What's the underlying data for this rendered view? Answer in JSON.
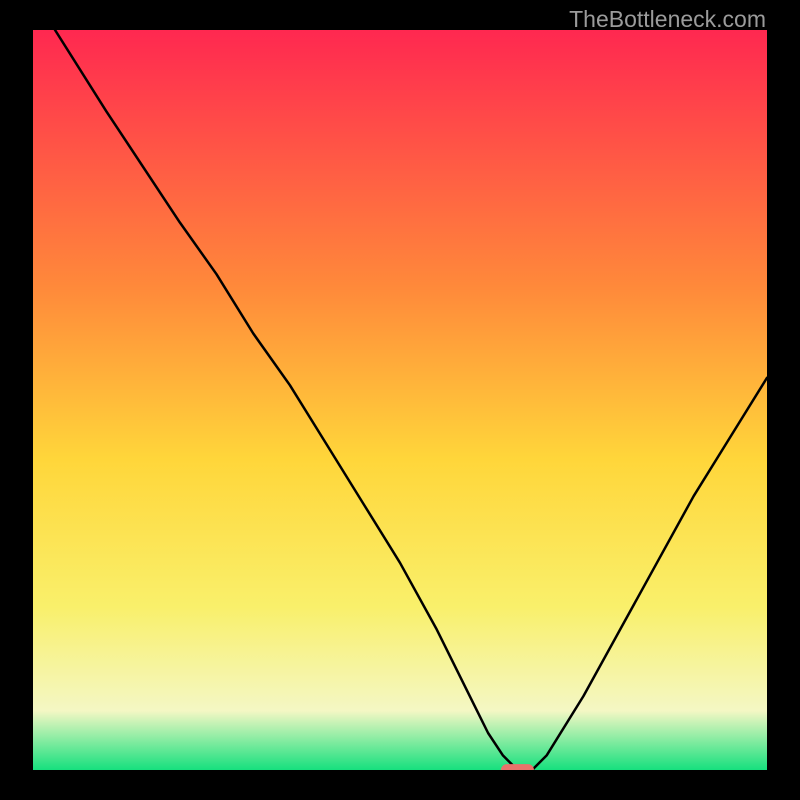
{
  "watermark": "TheBottleneck.com",
  "chart_data": {
    "type": "line",
    "title": "",
    "xlabel": "",
    "ylabel": "",
    "xlim": [
      0,
      100
    ],
    "ylim": [
      0,
      100
    ],
    "gradient_colors": {
      "top": "#ff2850",
      "mid_upper": "#ff8a3a",
      "mid": "#ffd63a",
      "mid_lower": "#f9f06b",
      "lower": "#f4f7c4",
      "bottom": "#16e07e"
    },
    "series": [
      {
        "name": "bottleneck-curve",
        "x": [
          3,
          10,
          20,
          25,
          30,
          35,
          40,
          45,
          50,
          55,
          58,
          60,
          62,
          64,
          66,
          68,
          70,
          75,
          80,
          85,
          90,
          95,
          100
        ],
        "y": [
          100,
          89,
          74,
          67,
          59,
          52,
          44,
          36,
          28,
          19,
          13,
          9,
          5,
          2,
          0,
          0,
          2,
          10,
          19,
          28,
          37,
          45,
          53
        ]
      }
    ],
    "marker": {
      "name": "optimal-point",
      "x": 66,
      "y": 0,
      "color": "#e8736b",
      "width_pct": 4.5,
      "height_pct": 1.6
    }
  }
}
